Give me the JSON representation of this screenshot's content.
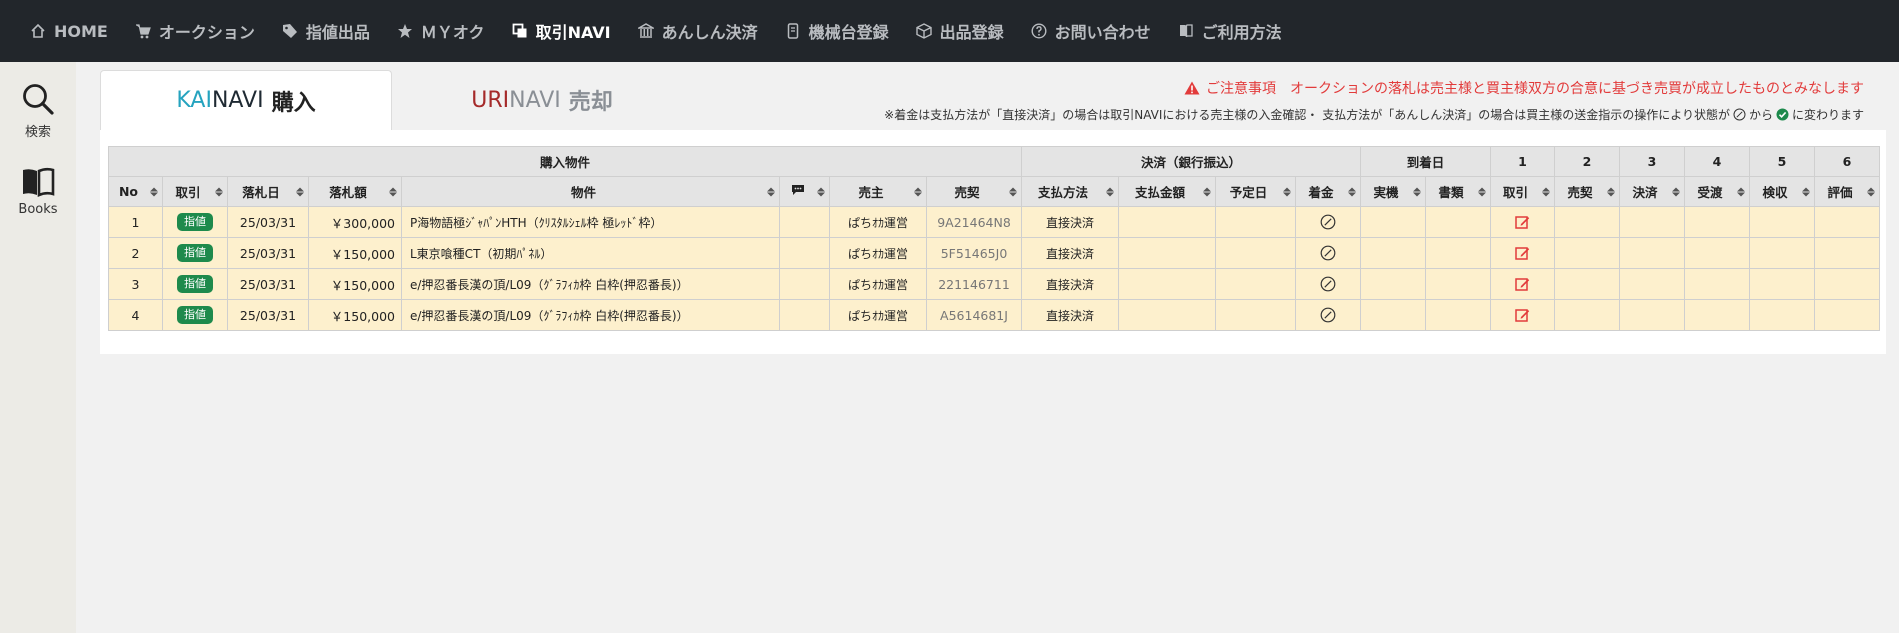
{
  "nav": {
    "items": [
      {
        "label": "HOME",
        "icon": "home-icon",
        "active": false
      },
      {
        "label": "オークション",
        "icon": "cart-icon",
        "active": false
      },
      {
        "label": "指値出品",
        "icon": "tag-icon",
        "active": false
      },
      {
        "label": "ＭＹオク",
        "icon": "star-icon",
        "active": false
      },
      {
        "label": "取引NAVI",
        "icon": "copy-icon",
        "active": true
      },
      {
        "label": "あんしん決済",
        "icon": "bank-icon",
        "active": false
      },
      {
        "label": "機械台登録",
        "icon": "device-icon",
        "active": false
      },
      {
        "label": "出品登録",
        "icon": "box-icon",
        "active": false
      },
      {
        "label": "お問い合わせ",
        "icon": "question-icon",
        "active": false
      },
      {
        "label": "ご利用方法",
        "icon": "book-icon",
        "active": false
      }
    ]
  },
  "sidebar": {
    "search_label": "検索",
    "books_label": "Books"
  },
  "tabs": {
    "buy": {
      "prefix": "KAI",
      "navi": "NAVI",
      "word": "購入"
    },
    "sell": {
      "prefix": "URI",
      "navi": "NAVI",
      "word": "売却"
    }
  },
  "notice": {
    "caution": "ご注意事項　オークションの落札は売主様と買主様双方の合意に基づき売買が成立したものとみなします",
    "note_before": "※着金は支払方法が「直接決済」の場合は取引NAVIにおける売主様の入金確認・ 支払方法が「あんしん決済」の場合は買主様の送金指示の操作により状態が",
    "note_from": "から",
    "note_after": "に変わります"
  },
  "table": {
    "group_headers": {
      "purchase": "購入物件",
      "settlement": "決済（銀行振込）",
      "arrival": "到着日",
      "step1": "1",
      "step2": "2",
      "step3": "3",
      "step4": "4",
      "step5": "5",
      "step6": "6"
    },
    "columns": [
      "No",
      "取引",
      "落札日",
      "落札額",
      "物件",
      "",
      "売主",
      "売契",
      "支払方法",
      "支払金額",
      "予定日",
      "着金",
      "実機",
      "書類",
      "取引",
      "売契",
      "決済",
      "受渡",
      "検収",
      "評価"
    ],
    "rows": [
      {
        "no": "1",
        "deal": "指値",
        "date": "25/03/31",
        "price": "￥300,000",
        "item": "P海物語極ｼﾞｬﾊﾟﾝHTH（ｸﾘｽﾀﾙｼｪﾙ枠 極ﾚｯﾄﾞ枠）",
        "seller": "ぱちｵｶ運営",
        "contract": "9A21464N8",
        "method": "直接決済"
      },
      {
        "no": "2",
        "deal": "指値",
        "date": "25/03/31",
        "price": "￥150,000",
        "item": "L東京喰種CT（初期ﾊﾟﾈﾙ）",
        "seller": "ぱちｵｶ運営",
        "contract": "5F51465J0",
        "method": "直接決済"
      },
      {
        "no": "3",
        "deal": "指値",
        "date": "25/03/31",
        "price": "￥150,000",
        "item": "e/押忍番長漢の頂/L09（ｸﾞﾗﾌｨｶ枠 白枠(押忍番長)）",
        "seller": "ぱちｵｶ運営",
        "contract": "221146711",
        "method": "直接決済"
      },
      {
        "no": "4",
        "deal": "指値",
        "date": "25/03/31",
        "price": "￥150,000",
        "item": "e/押忍番長漢の頂/L09（ｸﾞﾗﾌｨｶ枠 白枠(押忍番長)）",
        "seller": "ぱちｵｶ運営",
        "contract": "A5614681J",
        "method": "直接決済"
      }
    ]
  },
  "colors": {
    "nav_bg": "#22262b",
    "row_bg": "#fdf0cd",
    "badge": "#1e8a4c",
    "caution": "#e23b3b",
    "kai": "#25a3bf",
    "uri": "#a52a2a"
  }
}
